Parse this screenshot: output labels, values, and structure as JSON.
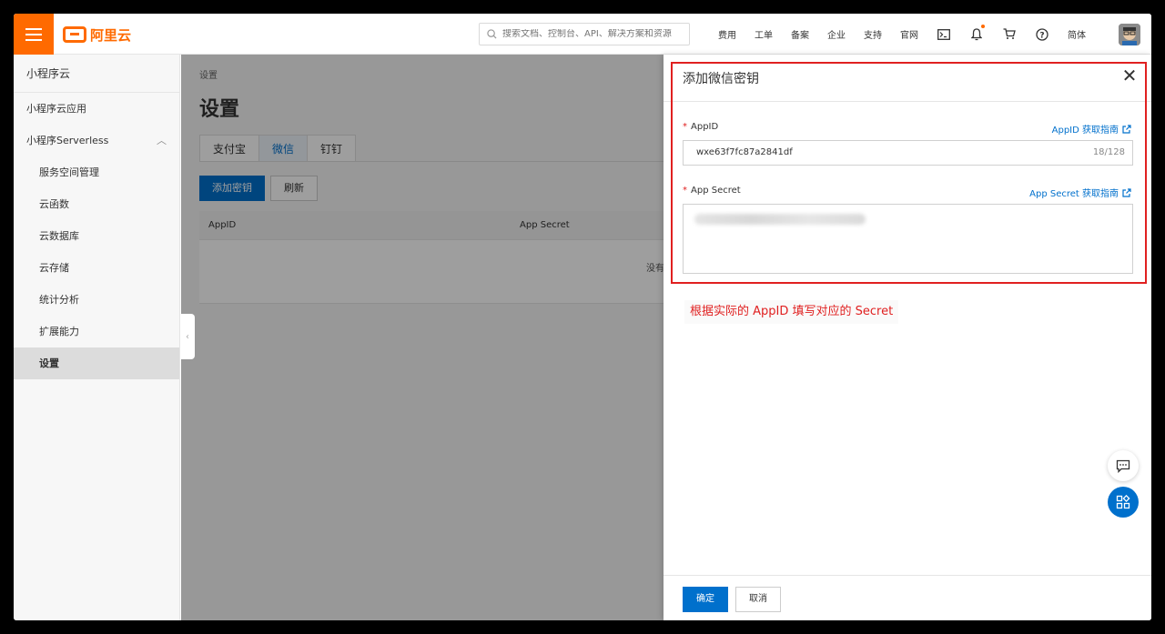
{
  "header": {
    "brand": "阿里云",
    "search_placeholder": "搜索文档、控制台、API、解决方案和资源",
    "nav": [
      "费用",
      "工单",
      "备案",
      "企业",
      "支持",
      "官网"
    ],
    "lang": "简体",
    "icons": [
      "terminal-icon",
      "bell-icon",
      "cart-icon",
      "help-icon"
    ]
  },
  "sidebar": {
    "title": "小程序云",
    "items": [
      {
        "label": "小程序云应用"
      },
      {
        "label": "小程序Serverless",
        "chevron": "^"
      },
      {
        "label": "服务空间管理"
      },
      {
        "label": "云函数"
      },
      {
        "label": "云数据库"
      },
      {
        "label": "云存储"
      },
      {
        "label": "统计分析"
      },
      {
        "label": "扩展能力"
      },
      {
        "label": "设置"
      }
    ]
  },
  "main": {
    "breadcrumb": "设置",
    "title": "设置",
    "tabs": [
      "支付宝",
      "微信",
      "钉钉"
    ],
    "add_key": "添加密钥",
    "refresh": "刷新",
    "columns": [
      "AppID",
      "App Secret"
    ],
    "empty_text": "没有"
  },
  "drawer": {
    "title": "添加微信密钥",
    "appid_label": "AppID",
    "appid_guide": "AppID 获取指南",
    "appid_value": "wxe63f7fc87a2841df",
    "appid_count": "18/128",
    "secret_label": "App Secret",
    "secret_guide": "App Secret 获取指南",
    "annotation": "根据实际的 AppID 填写对应的 Secret",
    "ok": "确定",
    "cancel": "取消"
  },
  "colors": {
    "brand": "#ff6a00",
    "primary": "#0070cc",
    "annotation": "#e02020"
  }
}
